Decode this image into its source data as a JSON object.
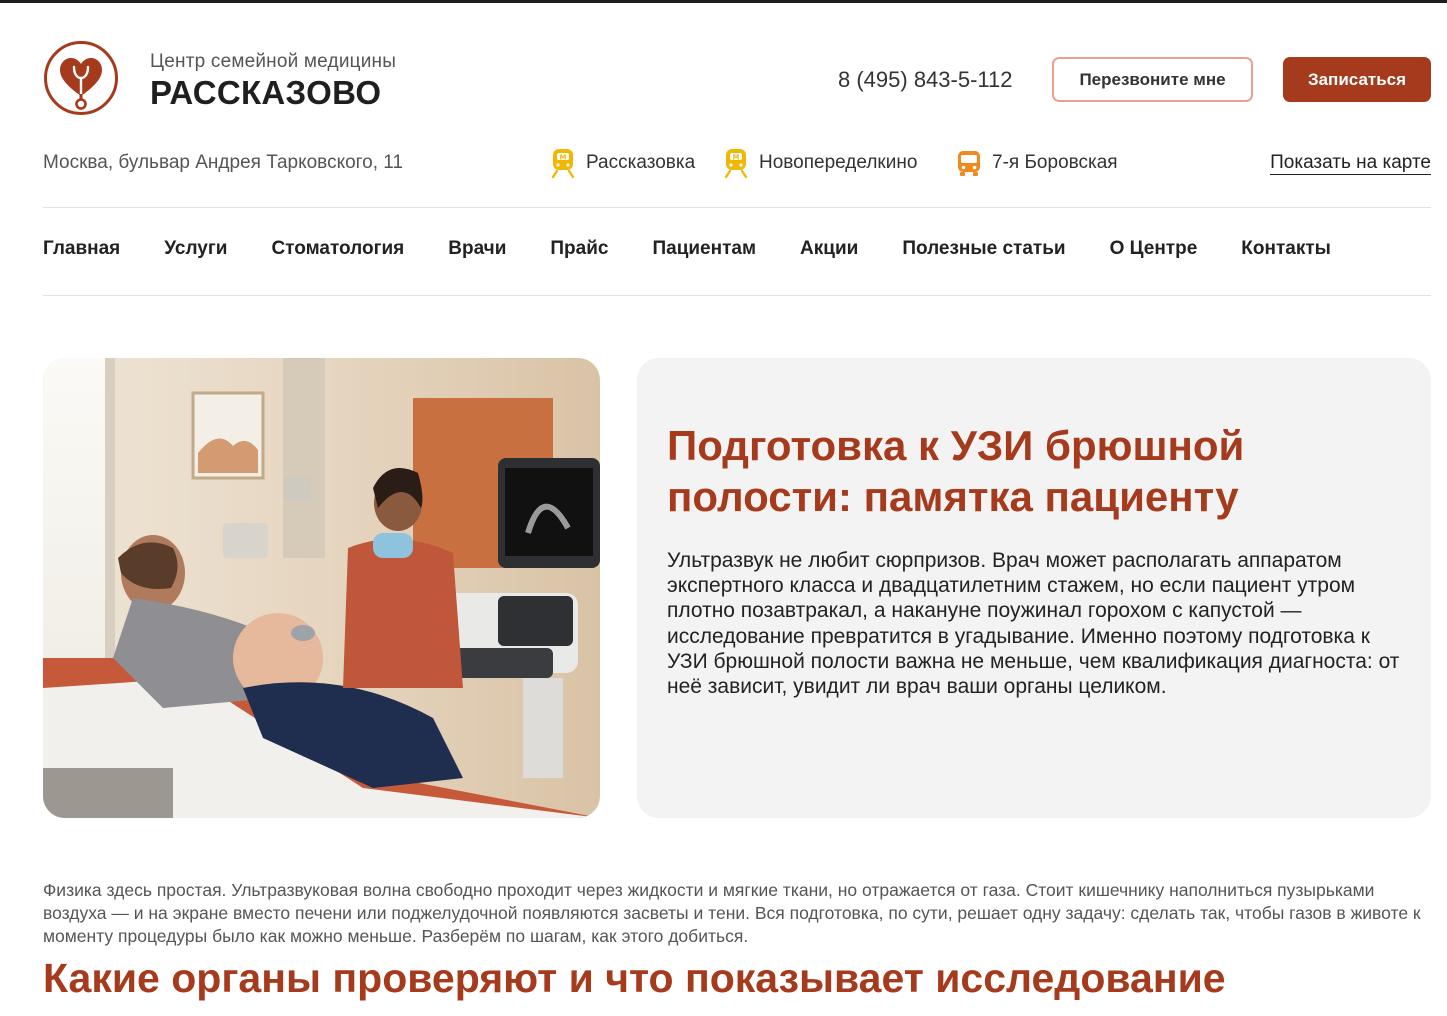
{
  "brand": {
    "subtitle": "Центр семейной медицины",
    "name": "РАССКАЗОВО",
    "accent_color": "#a63a1c",
    "logo_icon": "heart-stethoscope-logo"
  },
  "header": {
    "phone": "8 (495) 843-5-112",
    "callback_label": "Перезвоните мне",
    "signup_label": "Записаться"
  },
  "location": {
    "address": "Москва, бульвар Андрея Тарковского, 11",
    "stations": [
      {
        "name": "Рассказовка",
        "icon": "metro-icon"
      },
      {
        "name": "Новопеределкино",
        "icon": "metro-icon"
      },
      {
        "name": "7-я Боровская",
        "icon": "bus-icon"
      }
    ],
    "map_link": "Показать на карте"
  },
  "nav": {
    "items": [
      "Главная",
      "Услуги",
      "Стоматология",
      "Врачи",
      "Прайс",
      "Пациентам",
      "Акции",
      "Полезные статьи",
      "О Центре",
      "Контакты"
    ]
  },
  "hero": {
    "title": "Подготовка к УЗИ брюшной полости: памятка пациенту",
    "text": "Ультразвук не любит сюрпризов. Врач может располагать аппаратом экспертного класса и двадцатилетним стажем, но если пациент утром плотно позавтракал, а накануне поужинал горохом с капустой — исследование превратится в угадывание. Именно поэтому подготовка к УЗИ брюшной полости важна не меньше, чем квалификация диагноста: от неё зависит, увидит ли врач ваши органы целиком."
  },
  "article": {
    "intro": "Физика здесь простая. Ультразвуковая волна свободно проходит через жидкости и мягкие ткани, но отражается от газа. Стоит кишечнику наполниться пузырьками воздуха — и на экране вместо печени или поджелудочной появляются засветы и тени. Вся подготовка, по сути, решает одну задачу: сделать так, чтобы газов в животе к моменту процедуры было как можно меньше. Разберём по шагам, как этого добиться.",
    "section_title": "Какие органы проверяют и что показывает исследование"
  }
}
